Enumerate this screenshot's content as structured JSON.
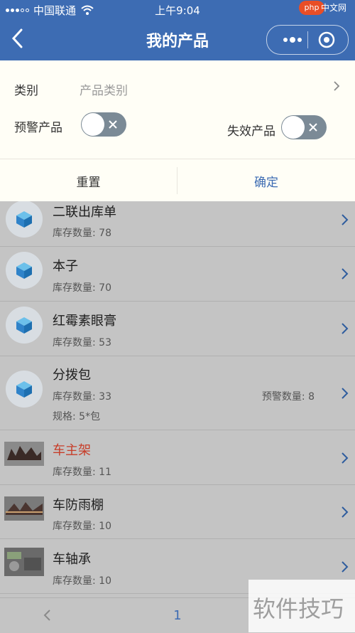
{
  "status_bar": {
    "carrier": "中国联通",
    "time": "上午9:04"
  },
  "nav": {
    "title": "我的产品"
  },
  "filter": {
    "category_label": "类别",
    "category_placeholder": "产品类别",
    "warning_label": "预警产品",
    "warning_on": false,
    "invalid_label": "失效产品",
    "invalid_on": false,
    "reset_label": "重置",
    "confirm_label": "确定"
  },
  "products": [
    {
      "name": "二联出库单",
      "stock": "库存数量: 78"
    },
    {
      "name": "本子",
      "stock": "库存数量: 70"
    },
    {
      "name": "红霉素眼膏",
      "stock": "库存数量: 53"
    },
    {
      "name": "分拨包",
      "stock": "库存数量: 33",
      "warn": "预警数量: 8",
      "spec": "规格: 5*包"
    },
    {
      "name": "车主架",
      "stock": "库存数量: 11",
      "highlight": true
    },
    {
      "name": "车防雨棚",
      "stock": "库存数量: 10"
    },
    {
      "name": "车轴承",
      "stock": "库存数量: 10"
    }
  ],
  "pager": {
    "current_page": "1"
  },
  "watermarks": {
    "php": "php",
    "php_cn": "中文网",
    "site": "软件技巧"
  },
  "colors": {
    "header": "#3d6cb3",
    "accent": "#3d6cb3",
    "highlight_text": "#c73e2a",
    "overlay_gray": "#c4c4c4"
  }
}
